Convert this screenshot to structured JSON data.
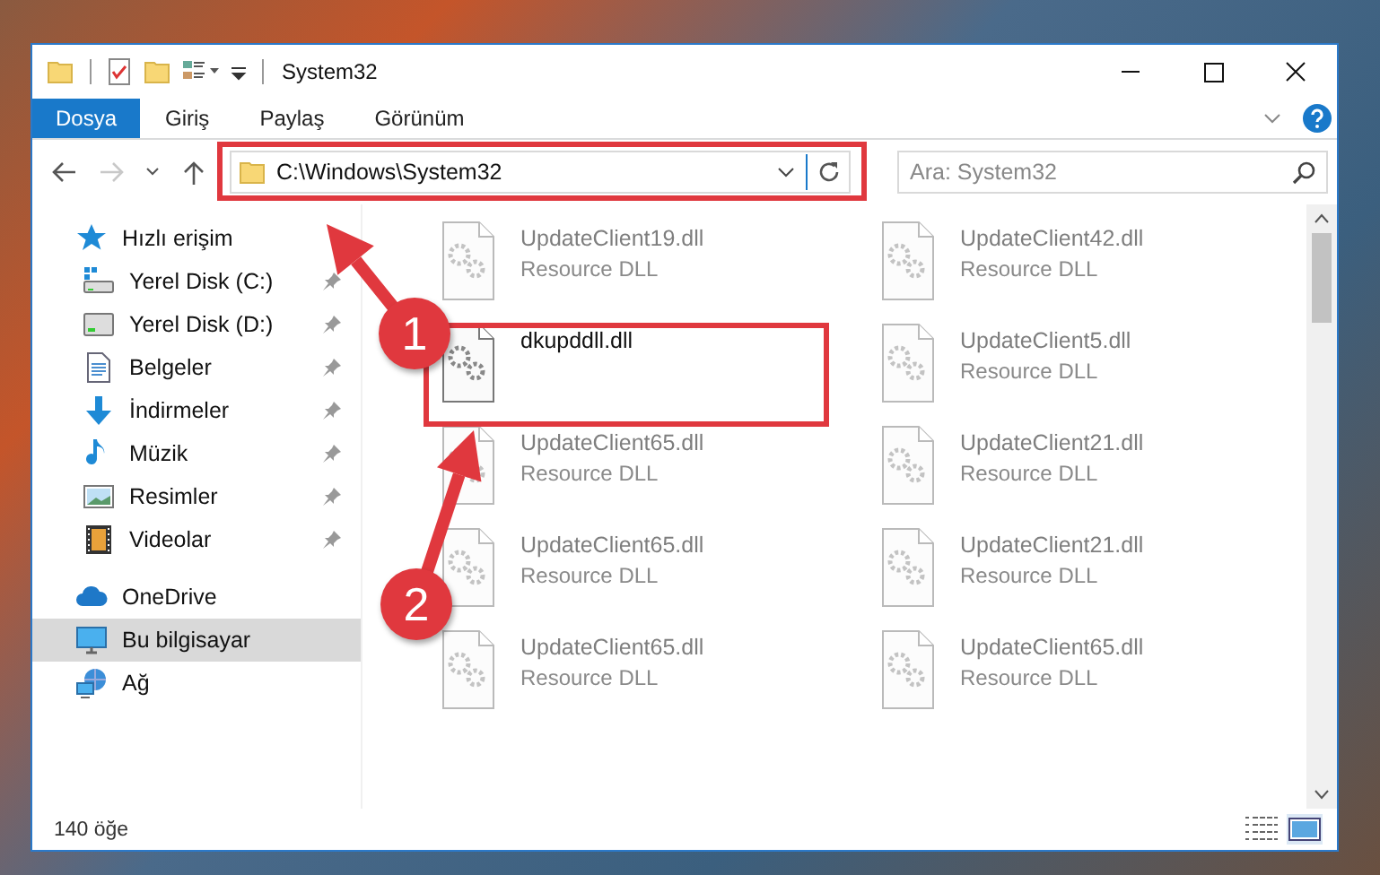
{
  "window": {
    "title": "System32"
  },
  "ribbon": {
    "tabs": [
      {
        "label": "Dosya",
        "kind": "file-menu",
        "selected": false
      },
      {
        "label": "Giriş",
        "kind": "tab",
        "selected": false
      },
      {
        "label": "Paylaş",
        "kind": "tab",
        "selected": false
      },
      {
        "label": "Görünüm",
        "kind": "tab",
        "selected": false
      }
    ]
  },
  "navigation": {
    "forward_disabled": true,
    "address": "C:\\Windows\\System32",
    "search": {
      "placeholder": "Ara: System32"
    }
  },
  "sidebar": {
    "items": [
      {
        "label": "Hızlı erişim",
        "kind": "quick-access",
        "selected": false,
        "children": [
          {
            "label": "Yerel Disk (C:)",
            "kind": "system-drive",
            "pinned": true,
            "selected": false
          },
          {
            "label": "Yerel Disk (D:)",
            "kind": "drive",
            "pinned": true,
            "selected": false
          },
          {
            "label": "Belgeler",
            "kind": "documents",
            "pinned": true,
            "selected": false
          },
          {
            "label": "İndirmeler",
            "kind": "downloads",
            "pinned": true,
            "selected": false
          },
          {
            "label": "Müzik",
            "kind": "music",
            "pinned": true,
            "selected": false
          },
          {
            "label": "Resimler",
            "kind": "pictures",
            "pinned": true,
            "selected": false
          },
          {
            "label": "Videolar",
            "kind": "videos",
            "pinned": true,
            "selected": false
          }
        ]
      },
      {
        "label": "OneDrive",
        "kind": "cloud",
        "selected": false
      },
      {
        "label": "Bu bilgisayar",
        "kind": "computer",
        "selected": true
      },
      {
        "label": "Ağ",
        "kind": "network",
        "selected": false
      }
    ]
  },
  "files": [
    {
      "name": "UpdateClient19.dll",
      "type": "Resource DLL",
      "blurred": true
    },
    {
      "name": "UpdateClient42.dll",
      "type": "Resource DLL",
      "blurred": true
    },
    {
      "name": "dkupddll.dll",
      "blurred": false
    },
    {
      "name": "UpdateClient5.dll",
      "type": "Resource DLL",
      "blurred": true
    },
    {
      "name": "UpdateClient65.dll",
      "type": "Resource DLL",
      "blurred": true
    },
    {
      "name": "UpdateClient21.dll",
      "type": "Resource DLL",
      "blurred": true
    },
    {
      "name": "UpdateClient65.dll",
      "type": "Resource DLL",
      "blurred": true
    },
    {
      "name": "UpdateClient21.dll",
      "type": "Resource DLL",
      "blurred": true
    },
    {
      "name": "UpdateClient65.dll",
      "type": "Resource DLL",
      "blurred": true
    },
    {
      "name": "UpdateClient65.dll",
      "type": "Resource DLL",
      "blurred": true
    }
  ],
  "status_bar": {
    "count": "140 öğe",
    "views": [
      {
        "kind": "details",
        "selected": false
      },
      {
        "kind": "large-icons",
        "selected": true
      }
    ]
  },
  "annotations": [
    {
      "label": "1"
    },
    {
      "label": "2"
    }
  ]
}
